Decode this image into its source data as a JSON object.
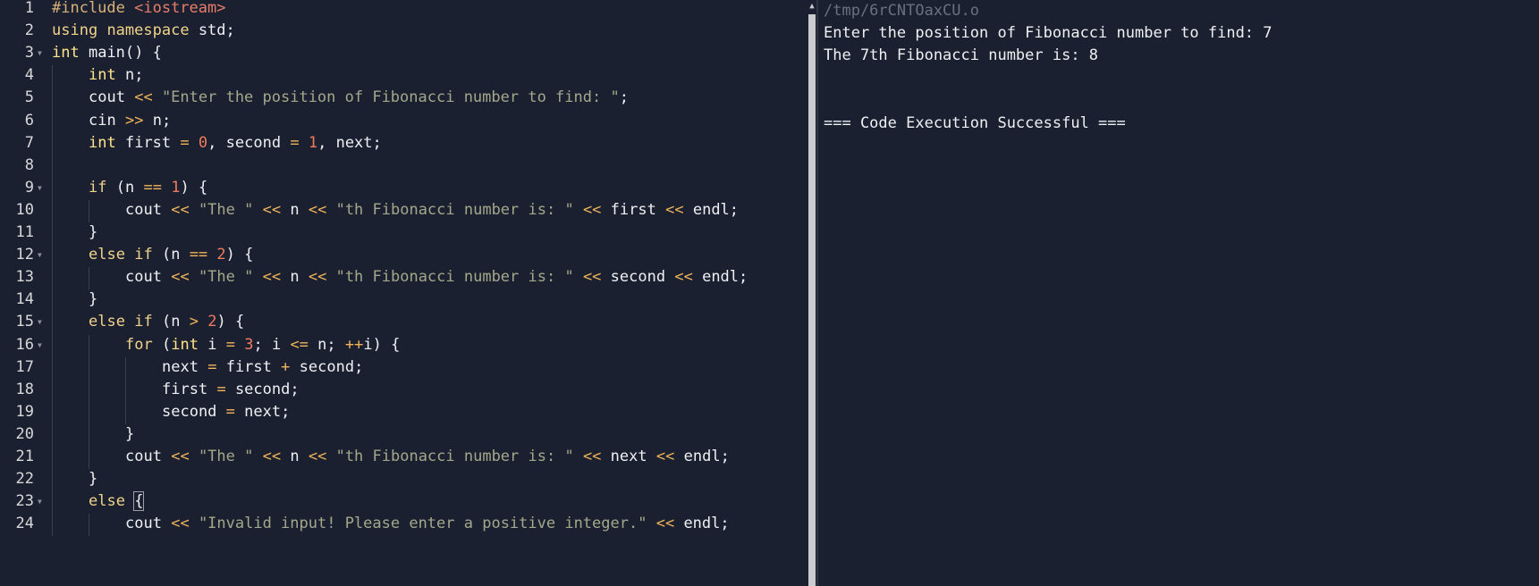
{
  "editor": {
    "lines": [
      {
        "n": "1",
        "text": "#include <iostream>"
      },
      {
        "n": "2",
        "text": "using namespace std;"
      },
      {
        "n": "3",
        "text": "int main() {"
      },
      {
        "n": "4",
        "text": "    int n;"
      },
      {
        "n": "5",
        "text": "    cout << \"Enter the position of Fibonacci number to find: \";"
      },
      {
        "n": "6",
        "text": "    cin >> n;"
      },
      {
        "n": "7",
        "text": "    int first = 0, second = 1, next;"
      },
      {
        "n": "8",
        "text": ""
      },
      {
        "n": "9",
        "text": "    if (n == 1) {"
      },
      {
        "n": "10",
        "text": "        cout << \"The \" << n << \"th Fibonacci number is: \" << first << endl;"
      },
      {
        "n": "11",
        "text": "    }"
      },
      {
        "n": "12",
        "text": "    else if (n == 2) {"
      },
      {
        "n": "13",
        "text": "        cout << \"The \" << n << \"th Fibonacci number is: \" << second << endl;"
      },
      {
        "n": "14",
        "text": "    }"
      },
      {
        "n": "15",
        "text": "    else if (n > 2) {"
      },
      {
        "n": "16",
        "text": "        for (int i = 3; i <= n; ++i) {"
      },
      {
        "n": "17",
        "text": "            next = first + second;"
      },
      {
        "n": "18",
        "text": "            first = second;"
      },
      {
        "n": "19",
        "text": "            second = next;"
      },
      {
        "n": "20",
        "text": "        }"
      },
      {
        "n": "21",
        "text": "        cout << \"The \" << n << \"th Fibonacci number is: \" << next << endl;"
      },
      {
        "n": "22",
        "text": "    }"
      },
      {
        "n": "23",
        "text": "    else {"
      },
      {
        "n": "24",
        "text": "        cout << \"Invalid input! Please enter a positive integer.\" << endl;"
      }
    ],
    "fold_lines": [
      "3",
      "9",
      "12",
      "15",
      "16",
      "23"
    ]
  },
  "output": {
    "path": "/tmp/6rCNTOaxCU.o",
    "line1": "Enter the position of Fibonacci number to find: 7",
    "line2": "The 7th Fibonacci number is: 8",
    "status": "=== Code Execution Successful ==="
  },
  "colors": {
    "background": "#1b2030",
    "keyword": "#f0d28a",
    "string": "#a4a88a",
    "number": "#f07b5e",
    "operator": "#f0b45a"
  }
}
